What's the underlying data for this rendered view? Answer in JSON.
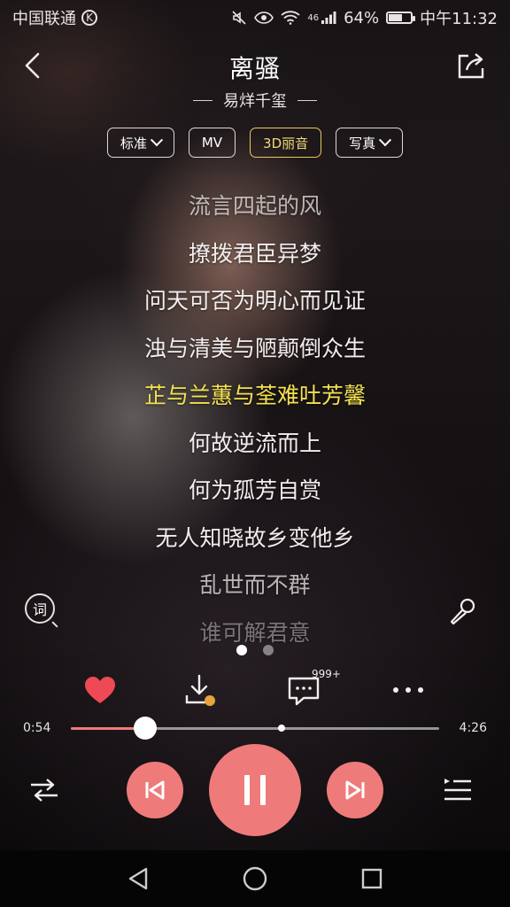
{
  "status_bar": {
    "carrier": "中国联通",
    "carrier_badge": "K",
    "network": "46",
    "battery_percent": "64%",
    "battery_level": 0.64,
    "time": "中午11:32"
  },
  "header": {
    "title": "离骚",
    "artist": "易烊千玺"
  },
  "chips": [
    {
      "label": "标准",
      "dropdown": true,
      "active": false
    },
    {
      "label": "MV",
      "dropdown": false,
      "active": false
    },
    {
      "label": "3D丽音",
      "dropdown": false,
      "active": true
    },
    {
      "label": "写真",
      "dropdown": true,
      "active": false
    }
  ],
  "lyrics": [
    {
      "text": "流言四起的风",
      "state": "fade"
    },
    {
      "text": "撩拨君臣异梦",
      "state": "normal"
    },
    {
      "text": "问天可否为明心而见证",
      "state": "normal"
    },
    {
      "text": "浊与清美与陋颠倒众生",
      "state": "normal"
    },
    {
      "text": "芷与兰蕙与荃难吐芳馨",
      "state": "current"
    },
    {
      "text": "何故逆流而上",
      "state": "normal"
    },
    {
      "text": "何为孤芳自赏",
      "state": "normal"
    },
    {
      "text": "无人知晓故乡变他乡",
      "state": "normal"
    },
    {
      "text": "乱世而不群",
      "state": "fade"
    },
    {
      "text": "谁可解君意",
      "state": "fade2"
    }
  ],
  "lyrics_icon_label": "词",
  "comments_count": "999+",
  "progress": {
    "elapsed": "0:54",
    "total": "4:26",
    "played_fraction": 0.203,
    "buffered_fraction": 0.573
  },
  "colors": {
    "accent": "#ee7b79",
    "current_lyric": "#f4e04f",
    "active_chip": "#e7c95f"
  },
  "icons": {
    "back": "chevron-left-icon",
    "share": "share-icon",
    "lyrics": "lyrics-search-icon",
    "mic": "microphone-icon",
    "like": "heart-icon",
    "download": "download-icon",
    "comment": "comment-icon",
    "more": "more-icon",
    "shuffle": "shuffle-icon",
    "prev": "previous-icon",
    "pause": "pause-icon",
    "next": "next-icon",
    "playlist": "playlist-icon"
  }
}
